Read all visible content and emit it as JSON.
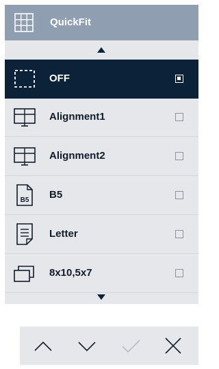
{
  "header": {
    "title": "QuickFit",
    "icon": "grid-icon"
  },
  "menu_items": [
    {
      "label": "OFF",
      "icon": "dashed-frame-icon",
      "selected": true
    },
    {
      "label": "Alignment1",
      "icon": "monitor-icon",
      "selected": false
    },
    {
      "label": "Alignment2",
      "icon": "monitor-icon",
      "selected": false
    },
    {
      "label": "B5",
      "icon": "b5-document-icon",
      "icon_text": "B5",
      "selected": false
    },
    {
      "label": "Letter",
      "icon": "letter-document-icon",
      "selected": false
    },
    {
      "label": "8x10,5x7",
      "icon": "stacked-frames-icon",
      "selected": false
    }
  ],
  "controls": [
    "up-chevron-icon",
    "down-chevron-icon",
    "check-icon",
    "close-icon"
  ],
  "colors": {
    "header_bg": "#8f9eb1",
    "menu_bg": "#e6e7ea",
    "selected_bg": "#0b2238",
    "text": "#101c2a",
    "disabled_check": "#b7bcc3"
  }
}
